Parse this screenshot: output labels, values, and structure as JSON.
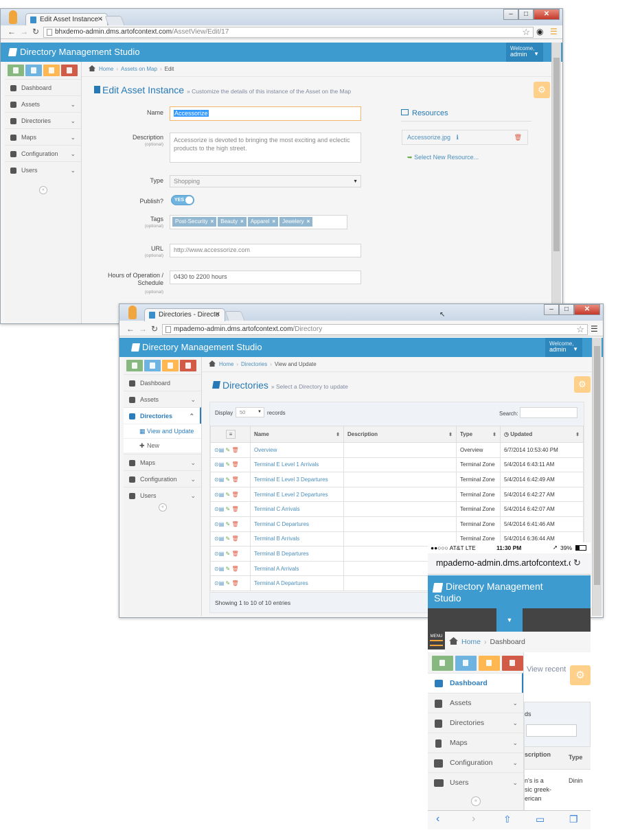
{
  "window1": {
    "tab_title": "Edit Asset Instance -",
    "url_host": "bhxdemo-admin.dms.artofcontext.com",
    "url_path": "/AssetView/Edit/17",
    "app_title": "Directory Management Studio",
    "welcome": "Welcome,",
    "user": "admin",
    "sidebar": [
      "Dashboard",
      "Assets",
      "Directories",
      "Maps",
      "Configuration",
      "Users"
    ],
    "breadcrumb": [
      "Home",
      "Assets on Map",
      "Edit"
    ],
    "page_title": "Edit Asset Instance",
    "page_subtitle": "» Customize the details of this instance of the Asset on the Map",
    "form": {
      "name_label": "Name",
      "name_value": "Accessorize",
      "description_label": "Description",
      "optional": "(optional)",
      "description_value": "Accessorize is devoted to bringing the most exciting and eclectic products to the high street.",
      "type_label": "Type",
      "type_value": "Shopping",
      "publish_label": "Publish?",
      "publish_value": "YES",
      "tags_label": "Tags",
      "tags": [
        "Post-Security",
        "Beauty",
        "Apparel",
        "Jewelery"
      ],
      "url_label": "URL",
      "url_placeholder": "http://www.accessorize.com",
      "hours_label_1": "Hours of Operation /",
      "hours_label_2": "Schedule",
      "hours_value": "0430 to 2200 hours"
    },
    "resources": {
      "title": "Resources",
      "file": "Accessorize.jpg",
      "select_new": "Select New Resource..."
    }
  },
  "window2": {
    "tab_title": "Directories - Directo",
    "url_host": "mpademo-admin.dms.artofcontext.com",
    "url_path": "/Directory",
    "app_title": "Directory Management Studio",
    "welcome": "Welcome,",
    "user": "admin",
    "sidebar": [
      "Dashboard",
      "Assets",
      "Directories",
      "Maps",
      "Configuration",
      "Users"
    ],
    "submenu": [
      "View and Update",
      "New"
    ],
    "breadcrumb": [
      "Home",
      "Directories",
      "View and Update"
    ],
    "page_title": "Directories",
    "page_subtitle": "» Select a Directory to update",
    "display_label": "Display",
    "display_value": "50",
    "records_label": "records",
    "search_label": "Search:",
    "columns": [
      "Name",
      "Description",
      "Type",
      "Updated"
    ],
    "rows": [
      {
        "name": "Overview",
        "description": "",
        "type": "Overview",
        "updated": "6/7/2014 10:53:40 PM"
      },
      {
        "name": "Terminal E Level 1 Arrivals",
        "description": "",
        "type": "Terminal Zone",
        "updated": "5/4/2014 6:43:11 AM"
      },
      {
        "name": "Terminal E Level 3 Departures",
        "description": "",
        "type": "Terminal Zone",
        "updated": "5/4/2014 6:42:49 AM"
      },
      {
        "name": "Terminal E Level 2 Departures",
        "description": "",
        "type": "Terminal Zone",
        "updated": "5/4/2014 6:42:27 AM"
      },
      {
        "name": "Terminal C Arrivals",
        "description": "",
        "type": "Terminal Zone",
        "updated": "5/4/2014 6:42:07 AM"
      },
      {
        "name": "Terminal C Departures",
        "description": "",
        "type": "Terminal Zone",
        "updated": "5/4/2014 6:41:46 AM"
      },
      {
        "name": "Terminal B Arrivals",
        "description": "",
        "type": "Terminal Zone",
        "updated": "5/4/2014 6:36:44 AM"
      },
      {
        "name": "Terminal B Departures",
        "description": "",
        "type": "",
        "updated": ""
      },
      {
        "name": "Terminal A Arrivals",
        "description": "",
        "type": "",
        "updated": ""
      },
      {
        "name": "Terminal A Departures",
        "description": "",
        "type": "",
        "updated": ""
      }
    ],
    "footer": "Showing 1 to 10 of 10 entries"
  },
  "phone": {
    "carrier": "●●○○○ AT&T  LTE",
    "time": "11:30 PM",
    "battery": "39%",
    "url": "mpademo-admin.dms.artofcontext.com",
    "app_title": "Directory Management Studio",
    "menu_label": "MENU",
    "breadcrumb": [
      "Home",
      "Dashboard"
    ],
    "view_recent": "View recent",
    "sidebar": [
      "Dashboard",
      "Assets",
      "Directories",
      "Maps",
      "Configuration",
      "Users"
    ],
    "peek": {
      "col_head": "scription",
      "type_head": "Type",
      "text_1": "n's is a",
      "text_2": "sic greek-",
      "text_3": "erican",
      "dining": "Dinin",
      "ds": "ds"
    }
  },
  "colors": {
    "brand": "#3d9bd0",
    "link": "#4c8fbd",
    "green": "#87b87f",
    "blue": "#6fb3e0",
    "orange": "#ffb752",
    "red": "#d15b47"
  }
}
